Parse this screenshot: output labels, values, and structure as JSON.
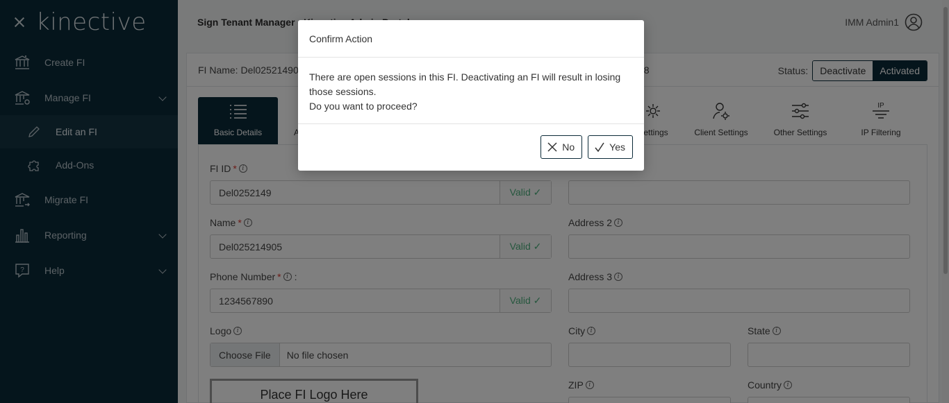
{
  "sidebar": {
    "logo": "kinective",
    "items": [
      {
        "label": "Create FI"
      },
      {
        "label": "Manage FI"
      },
      {
        "label": "Edit an FI"
      },
      {
        "label": "Add-Ons"
      },
      {
        "label": "Migrate FI"
      },
      {
        "label": "Reporting"
      },
      {
        "label": "Help"
      }
    ]
  },
  "header": {
    "title": "Sign Tenant Manager - Kinective Admin Portal",
    "user": "IMM Admin1"
  },
  "info": {
    "fi_name": "FI Name: Del025214905",
    "code_fragment": "28",
    "status_label": "Status:",
    "deactivate": "Deactivate",
    "activated": "Activated"
  },
  "tabs": [
    {
      "label": "Basic Details"
    },
    {
      "label": "A"
    },
    {
      "label": "Settings"
    },
    {
      "label": "Client Settings"
    },
    {
      "label": "Other Settings"
    },
    {
      "label": "IP Filtering"
    }
  ],
  "form": {
    "fi_id_label": "FI ID",
    "fi_id_value": "Del0252149",
    "name_label": "Name",
    "name_value": "Del025214905",
    "phone_label": "Phone Number",
    "phone_colon": ":",
    "phone_value": "1234567890",
    "valid": "Valid ✓",
    "logo_label": "Logo",
    "choose_file": "Choose File",
    "no_file": "No file chosen",
    "place_logo": "Place FI Logo Here",
    "address2_label": "Address 2",
    "address3_label": "Address 3",
    "city_label": "City",
    "state_label": "State",
    "zip_label": "ZIP",
    "country_label": "Country"
  },
  "modal": {
    "title": "Confirm Action",
    "line1": "There are open sessions in this FI. Deactivating an FI will result in losing those sessions.",
    "line2": "Do you want to proceed?",
    "no": "No",
    "yes": "Yes"
  }
}
